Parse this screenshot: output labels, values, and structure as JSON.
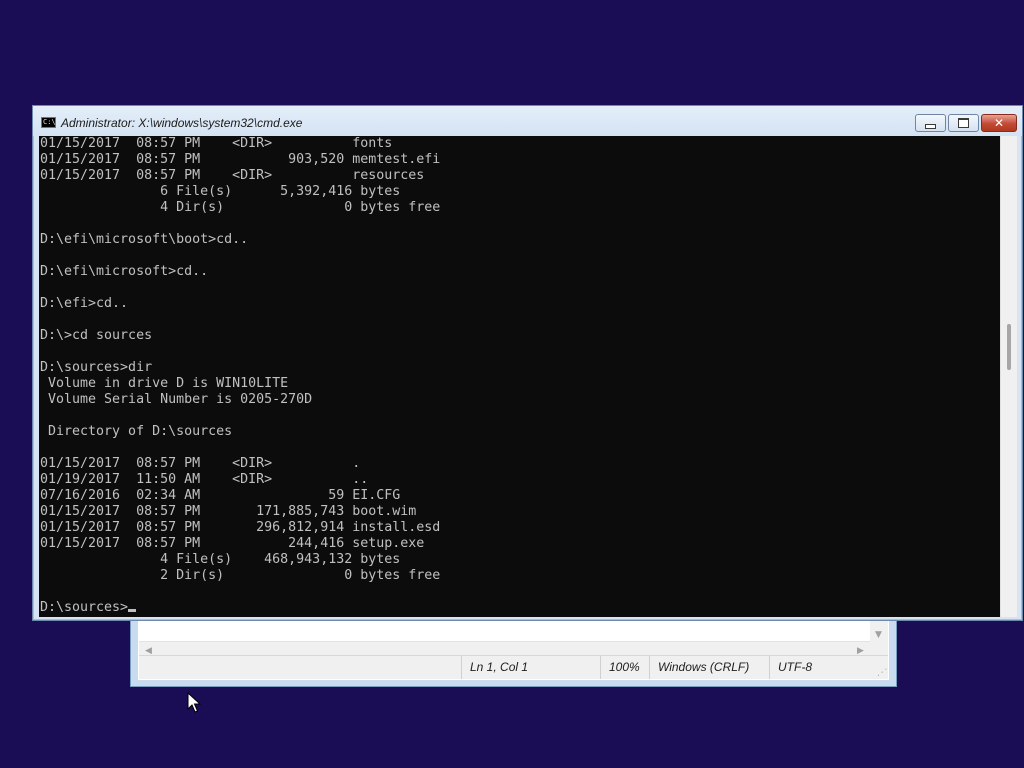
{
  "background_color": "#1a0d56",
  "cmd_window": {
    "title": "Administrator: X:\\windows\\system32\\cmd.exe",
    "icon": "cmd-icon",
    "icon_text": "C:\\",
    "buttons": {
      "minimize": "minimize-icon",
      "maximize": "maximize-icon",
      "close": "close-icon",
      "close_glyph": "✕"
    },
    "console_lines": [
      "01/15/2017  08:57 PM    <DIR>          fonts",
      "01/15/2017  08:57 PM           903,520 memtest.efi",
      "01/15/2017  08:57 PM    <DIR>          resources",
      "               6 File(s)      5,392,416 bytes",
      "               4 Dir(s)               0 bytes free",
      "",
      "D:\\efi\\microsoft\\boot>cd..",
      "",
      "D:\\efi\\microsoft>cd..",
      "",
      "D:\\efi>cd..",
      "",
      "D:\\>cd sources",
      "",
      "D:\\sources>dir",
      " Volume in drive D is WIN10LITE",
      " Volume Serial Number is 0205-270D",
      "",
      " Directory of D:\\sources",
      "",
      "01/15/2017  08:57 PM    <DIR>          .",
      "01/19/2017  11:50 AM    <DIR>          ..",
      "07/16/2016  02:34 AM                59 EI.CFG",
      "01/15/2017  08:57 PM       171,885,743 boot.wim",
      "01/15/2017  08:57 PM       296,812,914 install.esd",
      "01/15/2017  08:57 PM           244,416 setup.exe",
      "               4 File(s)    468,943,132 bytes",
      "               2 Dir(s)               0 bytes free",
      ""
    ],
    "prompt": "D:\\sources>"
  },
  "notepad_window": {
    "status_bar": {
      "position": "Ln 1, Col 1",
      "zoom": "100%",
      "line_ending": "Windows (CRLF)",
      "encoding": "UTF-8"
    },
    "scroll_arrows": {
      "left": "◀",
      "right": "▶",
      "down": "▼"
    },
    "grip": "⋰"
  }
}
